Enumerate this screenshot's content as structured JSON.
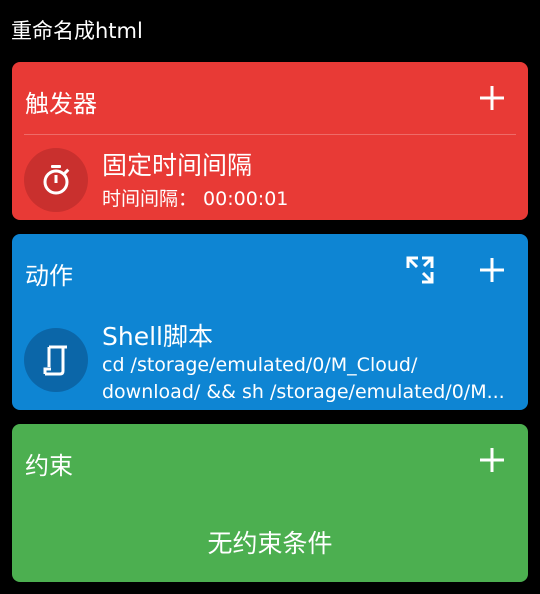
{
  "app": {
    "title": "重命名成html"
  },
  "trigger": {
    "title": "触发器",
    "item": {
      "name": "固定时间间隔",
      "detail": "时间间隔： 00:00:01",
      "icon": "timer-icon"
    },
    "color": "#E83A36"
  },
  "action": {
    "title": "动作",
    "item": {
      "name": "Shell脚本",
      "detail_line1": "cd  /storage/emulated/0/M_Cloud/",
      "detail_line2": "download/ && sh /storage/emulated/0/M...",
      "icon": "script-icon"
    },
    "color": "#0E85D3"
  },
  "constraint": {
    "title": "约束",
    "empty": "无约束条件",
    "color": "#4CAF50"
  },
  "icons": {
    "add": "plus-icon",
    "expand": "expand-icon"
  }
}
